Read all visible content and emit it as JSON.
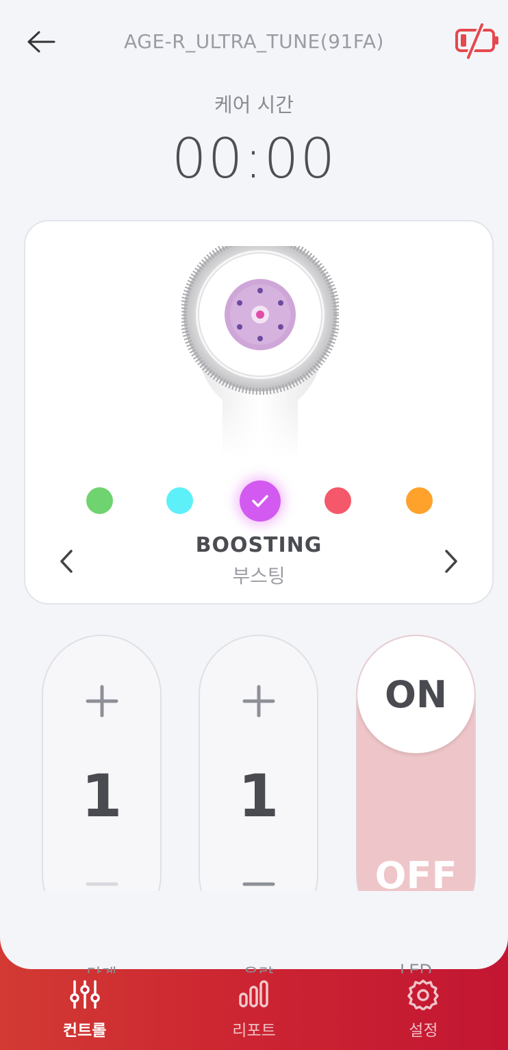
{
  "header": {
    "back_icon": "arrow-left-icon",
    "device_name": "AGE-R_ULTRA_TUNE(91FA)",
    "battery_icon": "battery-low-icon",
    "battery_color": "#e5484d"
  },
  "timer": {
    "label": "케어 시간",
    "value": "00:00"
  },
  "mode": {
    "colors": [
      {
        "name": "green",
        "hex": "#6fd36f",
        "selected": false
      },
      {
        "name": "cyan",
        "hex": "#5df0f8",
        "selected": false
      },
      {
        "name": "purple",
        "hex": "#d35af0",
        "selected": true
      },
      {
        "name": "red",
        "hex": "#f4586a",
        "selected": false
      },
      {
        "name": "orange",
        "hex": "#ffa22b",
        "selected": false
      }
    ],
    "name": "BOOSTING",
    "name_ko": "부스팅",
    "prev_icon": "chevron-left-icon",
    "next_icon": "chevron-right-icon"
  },
  "controls": {
    "level": {
      "value": "1",
      "label": "단계"
    },
    "volume": {
      "value": "1",
      "label": "음량"
    },
    "led": {
      "on_label": "ON",
      "off_label": "OFF",
      "label": "LED",
      "state": "on"
    }
  },
  "bottom_nav": {
    "items": [
      {
        "label": "컨트롤",
        "icon": "sliders-icon",
        "active": true
      },
      {
        "label": "리포트",
        "icon": "bar-chart-icon",
        "active": false
      },
      {
        "label": "설정",
        "icon": "gear-icon",
        "active": false
      }
    ]
  }
}
